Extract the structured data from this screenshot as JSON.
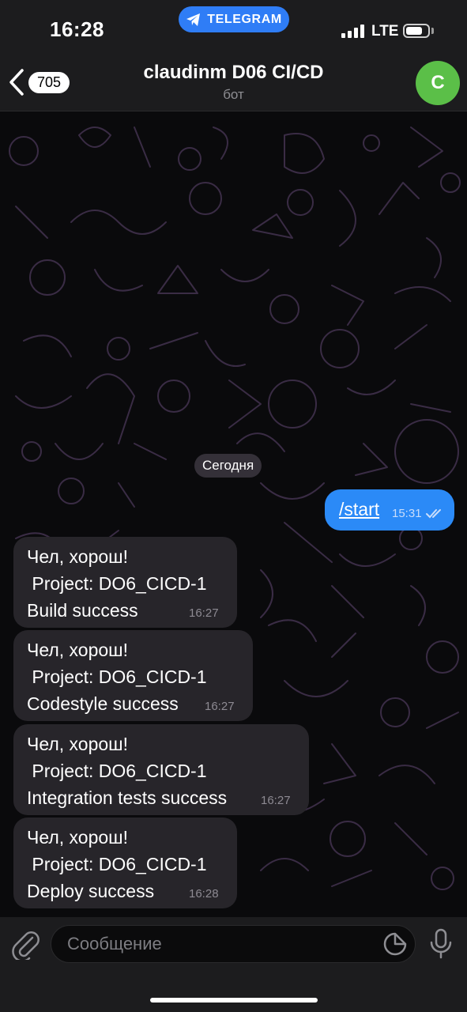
{
  "status_bar": {
    "time": "16:28",
    "app_pill": "TELEGRAM",
    "network": "LTE",
    "battery_level": 0.75
  },
  "header": {
    "back_count": "705",
    "title": "claudinm D06 CI/CD",
    "subtitle": "бот",
    "avatar_letter": "C",
    "avatar_color": "#5bbf48"
  },
  "chat": {
    "date_label": "Сегодня",
    "outgoing": [
      {
        "text": "/start",
        "time": "15:31",
        "status_icon": "double-check-icon"
      }
    ],
    "incoming": [
      {
        "line1": "Чел, хорош!",
        "line2": " Project: DO6_CICD-1",
        "line3": "Build success",
        "time": "16:27"
      },
      {
        "line1": "Чел, хорош!",
        "line2": " Project: DO6_CICD-1",
        "line3": "Codestyle success",
        "time": "16:27"
      },
      {
        "line1": "Чел, хорош!",
        "line2": " Project: DO6_CICD-1",
        "line3": "Integration tests success",
        "time": "16:27"
      },
      {
        "line1": "Чел, хорош!",
        "line2": " Project: DO6_CICD-1",
        "line3": "Deploy success",
        "time": "16:28"
      }
    ]
  },
  "input": {
    "placeholder": "Сообщение",
    "value": "",
    "attach_icon": "paperclip-icon",
    "sticker_icon": "sticker-icon",
    "mic_icon": "microphone-icon"
  },
  "colors": {
    "outgoing_bubble": "#2b8af7",
    "incoming_bubble": "#27252a",
    "telegram_pill": "#2f7df6"
  }
}
